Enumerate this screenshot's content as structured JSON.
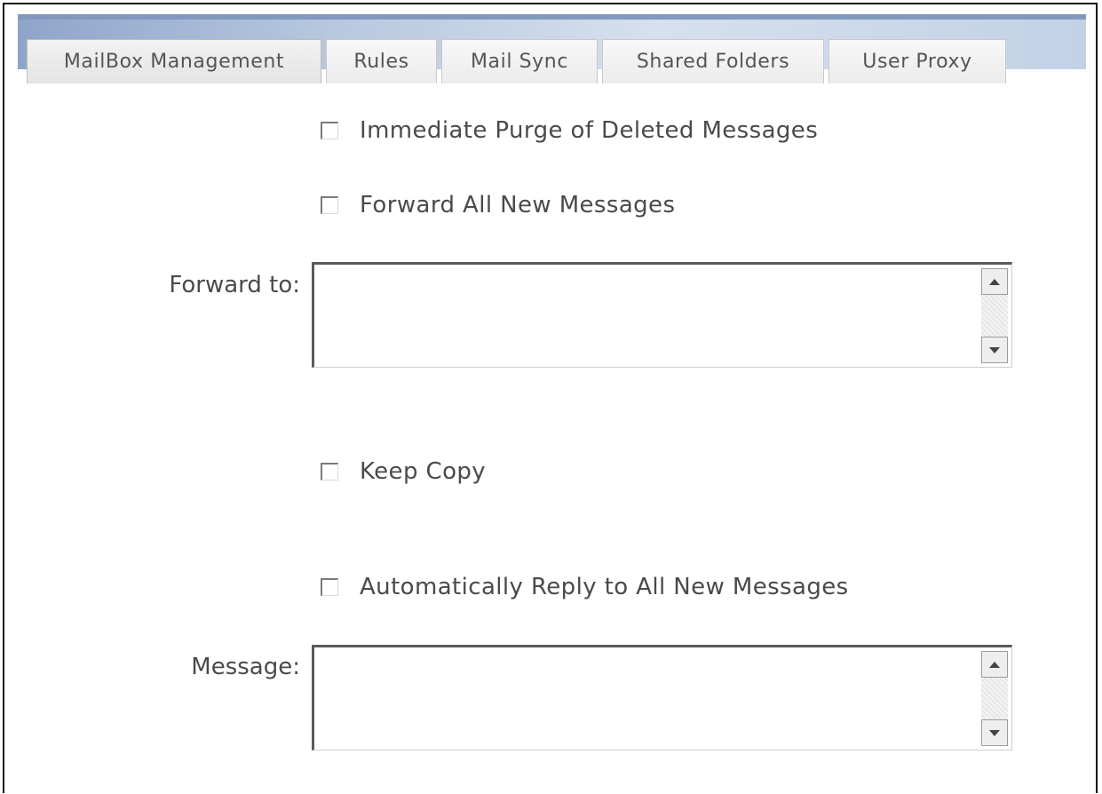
{
  "tabs": [
    {
      "label": "MailBox Management"
    },
    {
      "label": "Rules"
    },
    {
      "label": "Mail Sync"
    },
    {
      "label": "Shared Folders"
    },
    {
      "label": "User Proxy"
    }
  ],
  "options": {
    "immediate_purge": {
      "label": "Immediate Purge of Deleted Messages",
      "checked": false
    },
    "forward_all": {
      "label": "Forward All New Messages",
      "checked": false
    },
    "keep_copy": {
      "label": "Keep Copy",
      "checked": false
    },
    "auto_reply": {
      "label": "Automatically Reply to All New Messages",
      "checked": false
    }
  },
  "fields": {
    "forward_to": {
      "label": "Forward to:",
      "value": ""
    },
    "message": {
      "label": "Message:",
      "value": ""
    }
  },
  "icons": {
    "scroll_up": "triangle-up",
    "scroll_down": "triangle-down"
  }
}
